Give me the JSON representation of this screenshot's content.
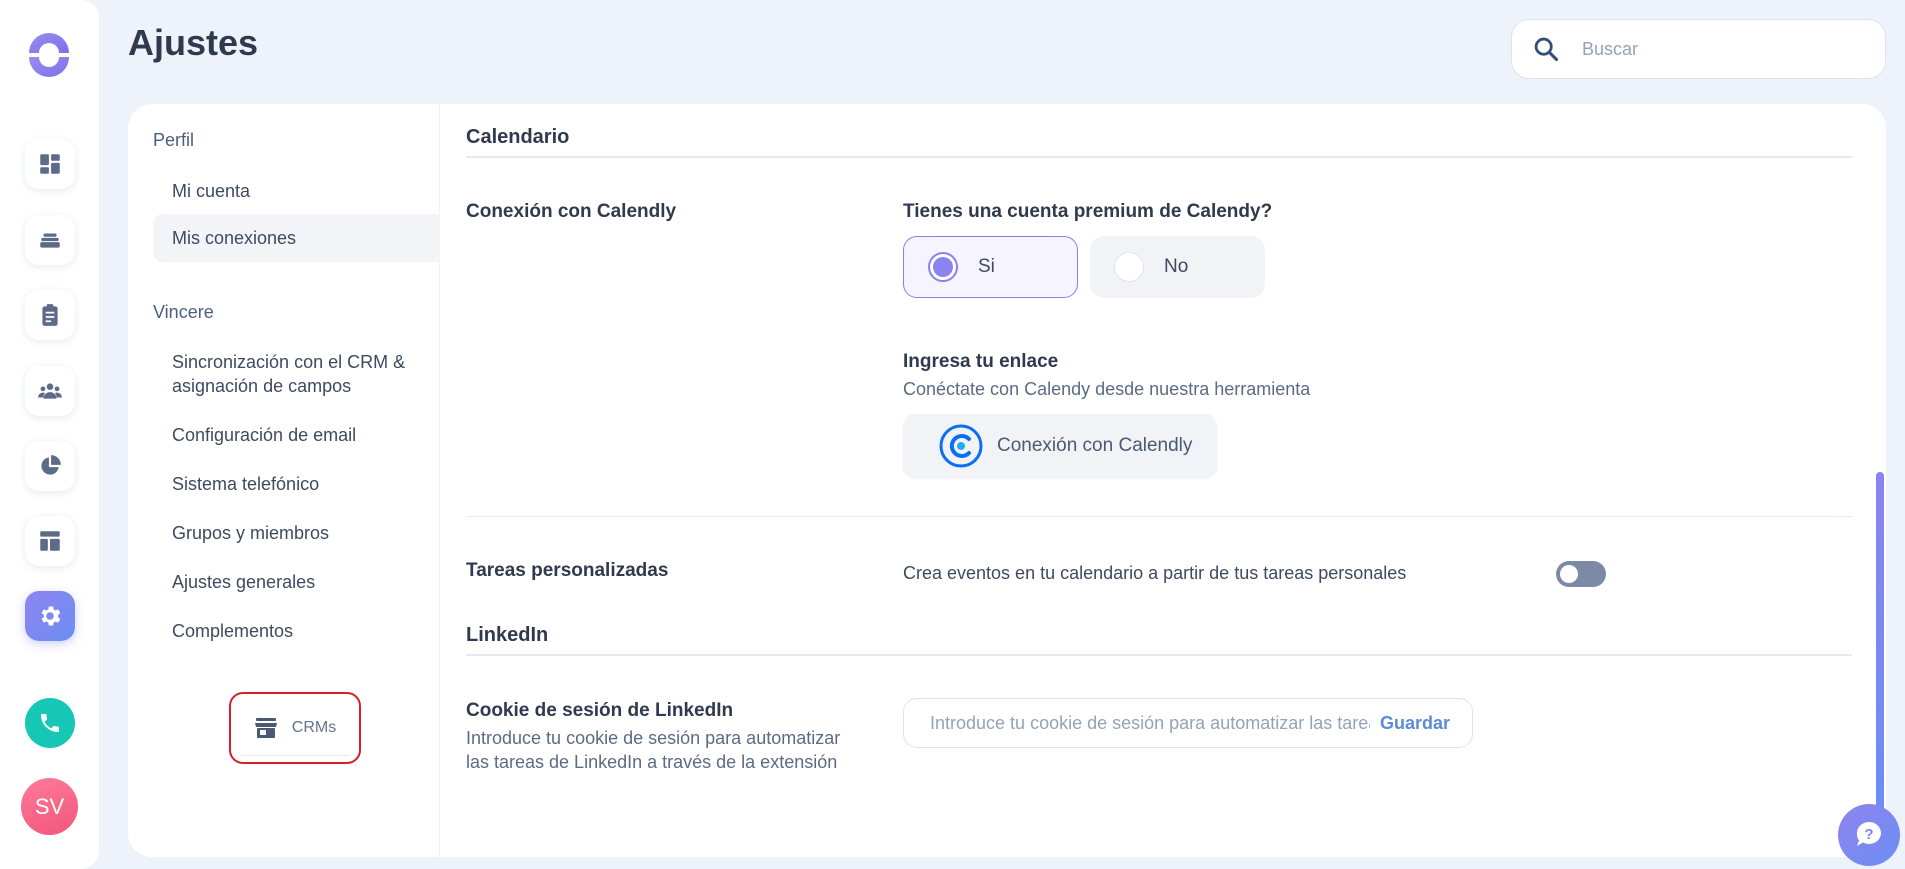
{
  "page": {
    "title": "Ajustes"
  },
  "search": {
    "placeholder": "Buscar"
  },
  "rail": {
    "items": [
      {
        "icon": "dashboard-icon",
        "active": false
      },
      {
        "icon": "stack-icon",
        "active": false
      },
      {
        "icon": "clipboard-icon",
        "active": false
      },
      {
        "icon": "team-icon",
        "active": false
      },
      {
        "icon": "pie-chart-icon",
        "active": false
      },
      {
        "icon": "layout-icon",
        "active": false
      },
      {
        "icon": "gear-icon",
        "active": true
      }
    ],
    "avatar_initials": "SV"
  },
  "side_nav": {
    "sections": [
      {
        "title": "Perfil",
        "items": [
          {
            "label": "Mi cuenta",
            "active": false
          },
          {
            "label": "Mis conexiones",
            "active": true
          }
        ]
      },
      {
        "title": "Vincere",
        "items": [
          {
            "label": "Sincronización con el CRM & asignación de campos",
            "active": false
          },
          {
            "label": "Configuración de email",
            "active": false
          },
          {
            "label": "Sistema telefónico",
            "active": false
          },
          {
            "label": "Grupos y miembros",
            "active": false
          },
          {
            "label": "Ajustes generales",
            "active": false
          },
          {
            "label": "Complementos",
            "active": false
          }
        ]
      }
    ],
    "crms_label": "CRMs"
  },
  "calendar": {
    "heading": "Calendario",
    "calendly_label": "Conexión con Calendly",
    "premium_question": "Tienes una cuenta premium de Calendy?",
    "options": [
      {
        "label": "Si",
        "selected": true
      },
      {
        "label": "No",
        "selected": false
      }
    ],
    "link_title": "Ingresa tu enlace",
    "link_subtitle": "Conéctate con Calendy desde nuestra herramienta",
    "connect_button": "Conexión con Calendly",
    "custom_tasks_label": "Tareas personalizadas",
    "custom_tasks_text": "Crea eventos en tu calendario a partir de tus tareas personales",
    "custom_tasks_enabled": false
  },
  "linkedin": {
    "heading": "LinkedIn",
    "cookie_label": "Cookie de sesión de LinkedIn",
    "cookie_description": "Introduce tu cookie de sesión para automatizar las tareas de LinkedIn a través de la extensión",
    "cookie_placeholder": "Introduce tu cookie de sesión para automatizar las tareas de LinkedIn",
    "save_label": "Guardar"
  },
  "colors": {
    "accent": "#8a84f0",
    "phone": "#17c7b5",
    "highlight_border": "#d81f2a"
  }
}
